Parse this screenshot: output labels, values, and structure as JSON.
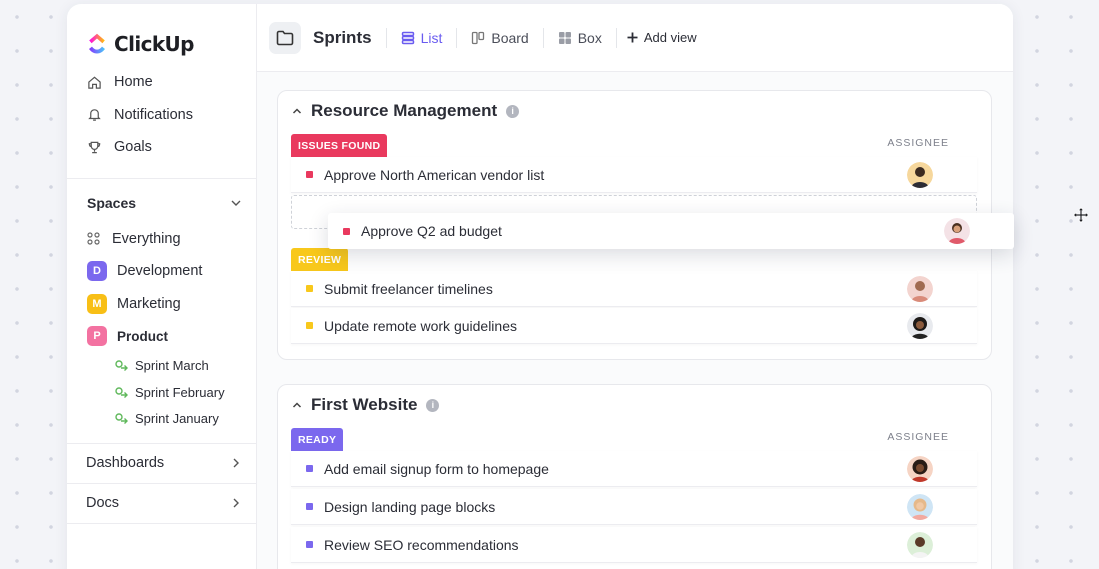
{
  "app": {
    "name": "ClickUp"
  },
  "sidebar": {
    "nav": [
      {
        "label": "Home",
        "icon": "home-icon"
      },
      {
        "label": "Notifications",
        "icon": "bell-icon"
      },
      {
        "label": "Goals",
        "icon": "trophy-icon"
      }
    ],
    "spaces_label": "Spaces",
    "everything_label": "Everything",
    "spaces": [
      {
        "letter": "D",
        "label": "Development",
        "color": "#7b68ee",
        "bold": false
      },
      {
        "letter": "M",
        "label": "Marketing",
        "color": "#f8bf16",
        "bold": false
      },
      {
        "letter": "P",
        "label": "Product",
        "color": "#f372a1",
        "bold": true
      }
    ],
    "sprints": [
      "Sprint  March",
      "Sprint  February",
      "Sprint  January"
    ],
    "sections": [
      "Dashboards",
      "Docs"
    ]
  },
  "header": {
    "title": "Sprints",
    "views": [
      {
        "label": "List",
        "icon": "list-icon",
        "active": true
      },
      {
        "label": "Board",
        "icon": "board-icon",
        "active": false
      },
      {
        "label": "Box",
        "icon": "box-icon",
        "active": false
      }
    ],
    "add_view": "Add view"
  },
  "lists": [
    {
      "title": "Resource Management",
      "groups": [
        {
          "status": "ISSUES FOUND",
          "status_color": "#e9395e",
          "status_text_color": "#ffffff",
          "assignee_label": "ASSIGNEE",
          "tasks": [
            {
              "name": "Approve North American vendor list",
              "color": "#e9395e",
              "avatar": "#f6d79c"
            }
          ]
        },
        {
          "status": "REVIEW",
          "status_color": "#f8c81c",
          "status_text_color": "#ffffff",
          "tasks": [
            {
              "name": "Submit freelancer timelines",
              "color": "#f8c81c",
              "avatar": "#f3d4cf"
            },
            {
              "name": "Update remote work guidelines",
              "color": "#f8c81c",
              "avatar": "#e8eaee"
            }
          ]
        }
      ]
    },
    {
      "title": "First Website",
      "groups": [
        {
          "status": "READY",
          "status_color": "#7b68ee",
          "status_text_color": "#ffffff",
          "assignee_label": "ASSIGNEE",
          "tasks": [
            {
              "name": "Add email signup form to homepage",
              "color": "#7b68ee",
              "avatar": "#f6d4c4"
            },
            {
              "name": "Design landing page blocks",
              "color": "#7b68ee",
              "avatar": "#cfe5f5"
            },
            {
              "name": "Review SEO recommendations",
              "color": "#7b68ee",
              "avatar": "#dcefd8"
            }
          ]
        }
      ]
    }
  ],
  "dragging_task": {
    "name": "Approve Q2 ad budget",
    "color": "#e9395e",
    "avatar": "#f4e2e6"
  }
}
